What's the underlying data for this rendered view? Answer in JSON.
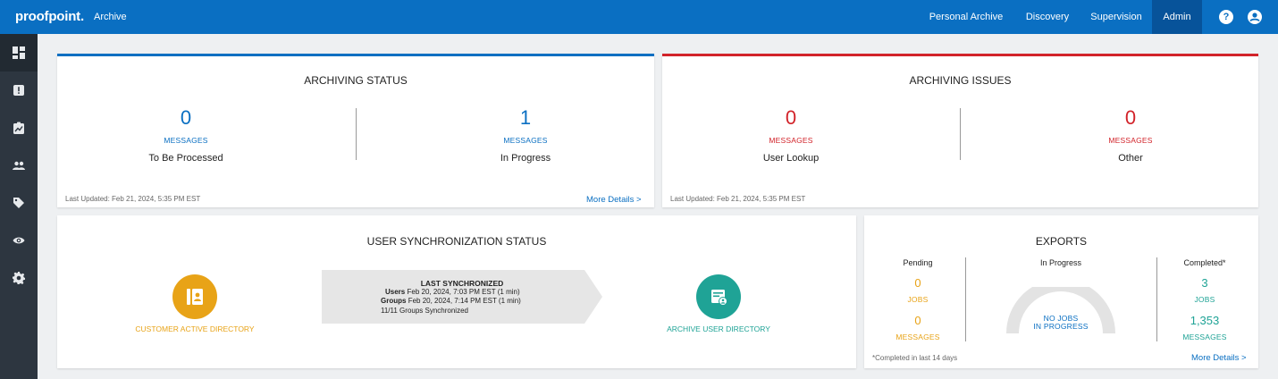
{
  "header": {
    "brand": "proofpoint.",
    "app": "Archive",
    "nav": [
      "Personal Archive",
      "Discovery",
      "Supervision",
      "Admin"
    ],
    "help_glyph": "?",
    "user_glyph": "☺"
  },
  "sidebar": {
    "items": [
      {
        "icon": "dashboard-icon",
        "active": true
      },
      {
        "icon": "alert-icon"
      },
      {
        "icon": "report-icon"
      },
      {
        "icon": "users-icon"
      },
      {
        "icon": "tag-icon"
      },
      {
        "icon": "eye-icon"
      },
      {
        "icon": "gear-icon"
      }
    ]
  },
  "archiving_status": {
    "title": "ARCHIVING STATUS",
    "left": {
      "value": "0",
      "unit": "MESSAGES",
      "label": "To Be Processed"
    },
    "right": {
      "value": "1",
      "unit": "MESSAGES",
      "label": "In Progress"
    },
    "updated": "Last Updated: Feb 21, 2024, 5:35 PM EST",
    "more": "More Details >"
  },
  "archiving_issues": {
    "title": "ARCHIVING ISSUES",
    "left": {
      "value": "0",
      "unit": "MESSAGES",
      "label": "User Lookup"
    },
    "right": {
      "value": "0",
      "unit": "MESSAGES",
      "label": "Other"
    },
    "updated": "Last Updated: Feb 21, 2024, 5:35 PM EST"
  },
  "user_sync": {
    "title": "USER SYNCHRONIZATION STATUS",
    "source_label": "CUSTOMER ACTIVE DIRECTORY",
    "target_label": "ARCHIVE USER DIRECTORY",
    "last_sync_title": "LAST SYNCHRONIZED",
    "users_key": "Users",
    "users_value": "Feb 20, 2024, 7:03 PM EST (1 min)",
    "groups_key": "Groups",
    "groups_value": "Feb 20, 2024, 7:14 PM EST (1 min)",
    "groups_synced": "11/11 Groups Synchronized",
    "colors": {
      "source": "#e8a317",
      "target": "#1fa396"
    }
  },
  "exports": {
    "title": "EXPORTS",
    "pending": {
      "head": "Pending",
      "jobs": "0",
      "jobs_unit": "JOBS",
      "messages": "0",
      "messages_unit": "MESSAGES"
    },
    "in_progress": {
      "head": "In Progress",
      "text1": "NO JOBS",
      "text2": "IN PROGRESS"
    },
    "completed": {
      "head": "Completed*",
      "jobs": "3",
      "jobs_unit": "JOBS",
      "messages": "1,353",
      "messages_unit": "MESSAGES"
    },
    "footnote": "*Completed in last 14 days",
    "more": "More Details >"
  }
}
